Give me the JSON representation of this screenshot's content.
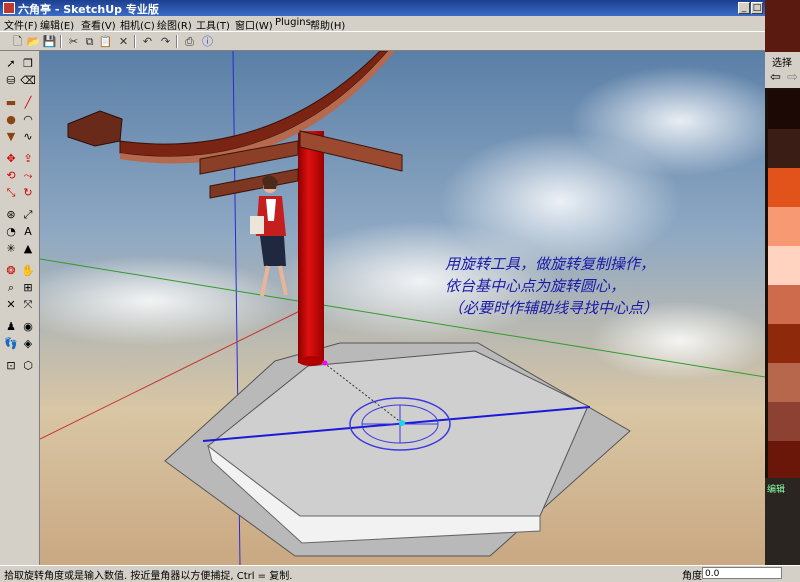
{
  "window": {
    "title": "六角亭 - SketchUp 专业版"
  },
  "menu": [
    {
      "label": "文件(F)"
    },
    {
      "label": "编辑(E)"
    },
    {
      "label": "查看(V)"
    },
    {
      "label": "相机(C)"
    },
    {
      "label": "绘图(R)"
    },
    {
      "label": "工具(T)"
    },
    {
      "label": "窗口(W)"
    },
    {
      "label": "Plugins"
    },
    {
      "label": "帮助(H)"
    }
  ],
  "toolbar": {
    "icons": [
      "new-icon",
      "open-icon",
      "save-icon",
      "cut-icon",
      "copy-icon",
      "paste-icon",
      "erase-icon",
      "undo-icon",
      "redo-icon",
      "print-icon",
      "info-icon"
    ]
  },
  "annotation": {
    "line1": "用旋转工具，做旋转复制操作，",
    "line2": "依台基中心点为旋转圆心，",
    "line3": "（必要时作辅助线寻找中心点）",
    "color": "#1a1aa8"
  },
  "status": {
    "message": "拾取旋转角度或是输入数值. 按近量角器以方便捕捉, Ctrl = 复制.",
    "value_label": "角度",
    "value": "0.0"
  },
  "right_panel": {
    "tab_label": "选择",
    "section_label": "编辑",
    "swatches": [
      "#1c0905",
      "#3a1e16",
      "#e2521b",
      "#f79a74",
      "#ffd3c0",
      "#cd6b4c",
      "#8e2a0b",
      "#b7684c",
      "#8c4132",
      "#6a1608"
    ]
  }
}
